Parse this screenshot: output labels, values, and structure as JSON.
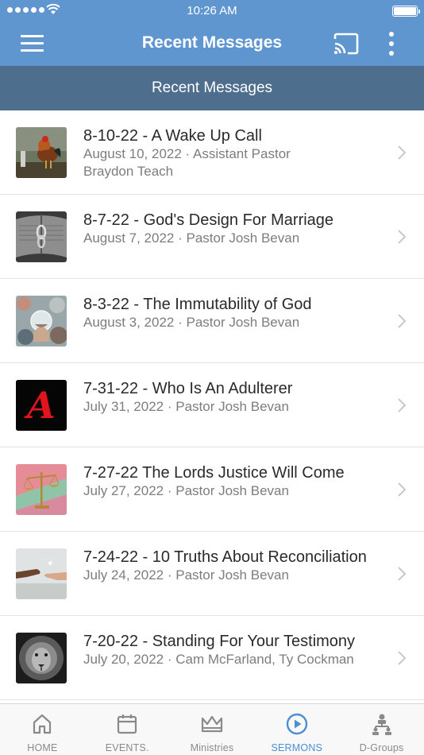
{
  "status_bar": {
    "time": "10:26 AM"
  },
  "app_bar": {
    "title": "Recent Messages"
  },
  "sub_header": {
    "title": "Recent Messages"
  },
  "messages": [
    {
      "title": "8-10-22 - A Wake Up Call",
      "meta_line1": "August 10, 2022 · Assistant Pastor",
      "meta_line2": "Braydon Teach",
      "thumb_icon": "rooster-thumbnail"
    },
    {
      "title": "8-7-22 - God's Design For Marriage",
      "meta_line1": "August 7, 2022 · Pastor Josh Bevan",
      "thumb_icon": "rings-bible-thumbnail"
    },
    {
      "title": "8-3-22 - The Immutability of God",
      "meta_line1": "August 3, 2022 · Pastor Josh Bevan",
      "thumb_icon": "crystal-ball-thumbnail"
    },
    {
      "title": "7-31-22 - Who Is An Adulterer",
      "meta_line1": "July 31, 2022 · Pastor Josh Bevan",
      "thumb_icon": "letter-a-thumbnail",
      "thumb_text": "A"
    },
    {
      "title": "7-27-22 The Lords Justice Will Come",
      "meta_line1": "July 27, 2022 · Pastor Josh Bevan",
      "thumb_icon": "scales-thumbnail"
    },
    {
      "title": "7-24-22 - 10 Truths About Reconciliation",
      "meta_line1": "July 24, 2022 · Pastor Josh Bevan",
      "thumb_icon": "hands-thumbnail"
    },
    {
      "title": "7-20-22 - Standing For Your Testimony",
      "meta_line1": "July 20, 2022 · Cam McFarland, Ty Cockman",
      "thumb_icon": "lion-thumbnail"
    }
  ],
  "tabs": [
    {
      "label": "HOME",
      "icon": "home-icon"
    },
    {
      "label": "EVENTS.",
      "icon": "calendar-icon"
    },
    {
      "label": "Ministries",
      "icon": "crown-icon"
    },
    {
      "label": "SERMONS",
      "icon": "play-circle-icon",
      "active": true
    },
    {
      "label": "D-Groups",
      "icon": "org-chart-icon"
    }
  ],
  "colors": {
    "header": "#5f96d0",
    "sub_header": "#4e6e8e",
    "active_tab": "#4a8fd4"
  }
}
